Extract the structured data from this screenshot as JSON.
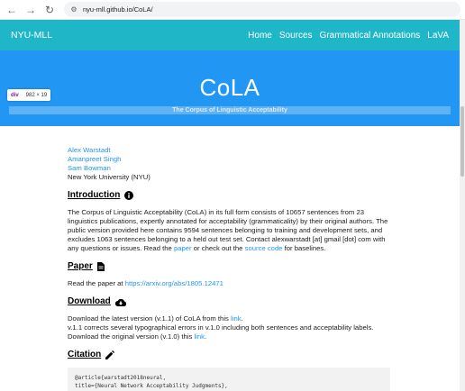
{
  "browser": {
    "url": "nyu-mll.github.io/CoLA/"
  },
  "navbar": {
    "brand": "NYU-MLL",
    "links": [
      "Home",
      "Sources",
      "Grammatical Annotations",
      "LaVA"
    ]
  },
  "hero": {
    "title": "CoLA",
    "subtitle": "The Corpus of Linguistic Acceptability"
  },
  "devtools_tooltip": {
    "tag": "div",
    "dims": "982 × 19"
  },
  "authors": [
    "Alex Warstadt",
    "Amanpreet Singh",
    "Sam Bowman"
  ],
  "affiliation": "New York University (NYU)",
  "introduction": {
    "heading": "Introduction",
    "text1": "The Corpus of Linguistic Acceptability (CoLA) in its full form consists of 10657 sentences from 23 linguistics publications, expertly annotated for acceptability (grammaticality) by their original authors. The public version provided here contains 9594 sentences belonging to training and development sets, and excludes 1063 sentences belonging to a held out test set. Contact alexwarstadt [at] gmail [dot] com with any questions or issues. Read the ",
    "paper_link": "paper",
    "text2": " or check out the ",
    "source_link": "source code",
    "text3": " for baselines."
  },
  "paper": {
    "heading": "Paper",
    "text": "Read the paper at ",
    "link": "https://arxiv.org/abs/1805.12471"
  },
  "download": {
    "heading": "Download",
    "line1_text": "Download the latest version (v.1.1) of CoLA from this ",
    "line1_link": "link",
    "line1_end": ".",
    "line2": "v.1.1 corrects several typographical errors in v.1.0 including both sentences and acceptability labels.",
    "line3_text": "Download the original version (v.1.0) this ",
    "line3_link": "link",
    "line3_end": "."
  },
  "citation": {
    "heading": "Citation",
    "code_line1": "@article{warstadt2018neural,",
    "code_line2": "  title={Neural Network Acceptability Judgments},"
  },
  "colors": {
    "navbar": "#1fb6c8",
    "hero": "#2196f3",
    "link": "#2196f3"
  }
}
